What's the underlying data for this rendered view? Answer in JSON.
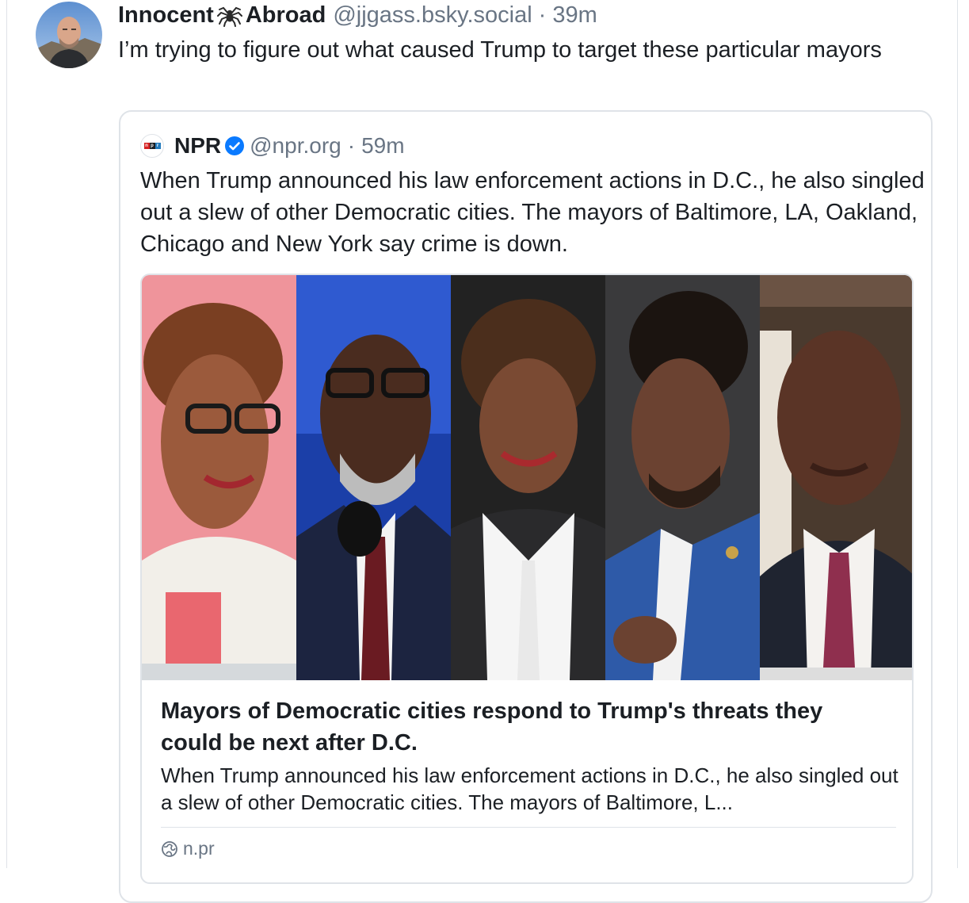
{
  "post": {
    "author_name_part1": "Innocent",
    "author_name_part2": "Abroad",
    "author_emoji": "spider-icon",
    "handle": "@jjgass.bsky.social",
    "separator": "·",
    "time": "39m",
    "text": "I’m trying to figure out what caused Trump to target these particular mayors"
  },
  "quote": {
    "author_name": "NPR",
    "logo": "npr-logo",
    "verified": true,
    "handle": "@npr.org",
    "separator": "·",
    "time": "59m",
    "text": "When Trump announced his law enforcement actions in D.C., he also singled out a slew of other Democratic cities. The mayors of Baltimore, LA, Oakland, Chicago and New York say crime is down."
  },
  "link_card": {
    "title": "Mayors of Democratic cities respond to Trump's threats they could be next after D.C.",
    "description": "When Trump announced his law enforcement actions in D.C., he also singled out a slew of other Democratic cities. The mayors of Baltimore, L...",
    "domain": "n.pr",
    "domain_icon": "globe-icon"
  },
  "colors": {
    "text": "#1b1f24",
    "muted": "#697584",
    "border": "#dfe3e8",
    "verified": "#0a7aff",
    "npr_red": "#d62021",
    "npr_blue": "#237bbd"
  }
}
